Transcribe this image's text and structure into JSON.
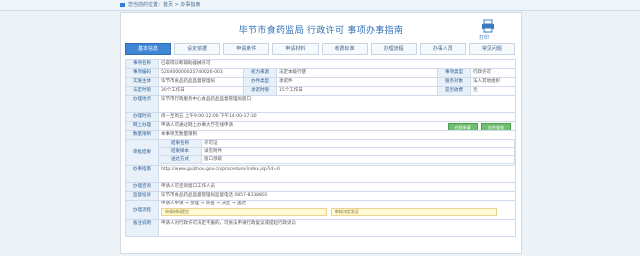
{
  "topbar": {
    "breadcrumb": "您当前的位置：首页 > 办事指南"
  },
  "header": {
    "title": "毕节市食药监局 行政许可 事项办事指南",
    "print_label": "打印"
  },
  "tabs": [
    {
      "label": "基本信息",
      "active": true
    },
    {
      "label": "设定依据",
      "active": false
    },
    {
      "label": "申请条件",
      "active": false
    },
    {
      "label": "申请材料",
      "active": false
    },
    {
      "label": "收费标准",
      "active": false
    },
    {
      "label": "办理流程",
      "active": false
    },
    {
      "label": "办事人员",
      "active": false
    },
    {
      "label": "常见问题",
      "active": false
    }
  ],
  "info": {
    "r1": {
      "label": "事项名称",
      "value": "已取得诊断辅助器械许可"
    },
    "r2": {
      "label": "事项编码",
      "value": "520400000025740026-003",
      "l2": "权力来源",
      "v2": "法定本级行使",
      "l3": "事项类型",
      "v3": "行政许可"
    },
    "r3": {
      "label": "实施主体",
      "value": "毕节市食品药品监督管理局",
      "l2": "办件类型",
      "v2": "承诺件",
      "l3": "服务对象",
      "v3": "法人其他组织"
    },
    "r4": {
      "label": "法定时限",
      "value": "30个工作日",
      "l2": "承诺时限",
      "v2": "15个工作日",
      "l3": "是否收费",
      "v3": "否"
    },
    "r5": {
      "label": "办理地点",
      "value": "毕节市行政服务中心食品药品监督管理局窗口"
    },
    "r6": {
      "label": "办理时间",
      "value": "周一至周五 上午9:00-12:00 下午14:00-17:30"
    },
    "online": {
      "label": "网上办理",
      "value": "申请人可通过网上办事大厅在线申请",
      "btn_apply": "在线申请",
      "btn_query": "办件查询"
    },
    "limits": {
      "label": "数量限制",
      "value": "本事项无数量限制"
    },
    "sample": {
      "label": "审批结果",
      "rows": [
        {
          "k": "结果名称",
          "v": "许可证"
        },
        {
          "k": "结果样本",
          "v": "详见附件"
        },
        {
          "k": "送达方式",
          "v": "窗口领取"
        }
      ]
    },
    "guide": {
      "label": "办事指南",
      "value": "http://www.guizhou.gov.cn/procedure/index.jsp?id=0"
    },
    "consult": {
      "label": "办理咨询",
      "value": "申请人可咨询窗口工作人员"
    },
    "complain": {
      "label": "监督投诉",
      "value": "毕节市食品药品监督管理局监督电话 0857-8338801"
    },
    "flow": {
      "label": "办理流程",
      "line1": "申请人申请 → 受理 → 审查 → 决定 → 送达",
      "hl1": "申请材料提交",
      "hl2": "审核决定发证"
    },
    "memo": {
      "label": "备注说明",
      "value": "申请人对行政许可决定不服的，可依法申请行政复议或提起行政诉讼"
    }
  }
}
